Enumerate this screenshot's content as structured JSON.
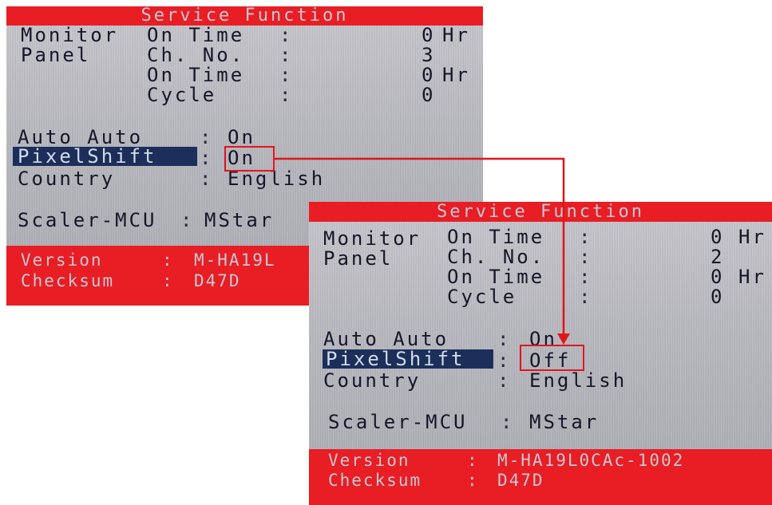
{
  "left_screen": {
    "title": "Service Function",
    "monitor_label": "Monitor",
    "panel_label": "Panel",
    "on_time_label": "On Time",
    "ch_no_label": "Ch. No.",
    "cycle_label": "Cycle",
    "colon": ":",
    "monitor_on_time_value": "0",
    "hr_unit": "Hr",
    "panel_ch_no_value": "3",
    "panel_on_time_value": "0",
    "panel_cycle_value": "0",
    "auto_auto_label": "Auto Auto",
    "auto_auto_value": "On",
    "pixelshift_label": "PixelShift",
    "pixelshift_value": "On",
    "country_label": "Country",
    "country_value": "English",
    "scaler_label": "Scaler-MCU",
    "scaler_value": "MStar",
    "version_label": "Version",
    "version_value": "M-HA19L",
    "checksum_label": "Checksum",
    "checksum_value": "D47D"
  },
  "right_screen": {
    "title": "Service Function",
    "monitor_label": "Monitor",
    "panel_label": "Panel",
    "on_time_label": "On Time",
    "ch_no_label": "Ch. No.",
    "cycle_label": "Cycle",
    "colon": ":",
    "monitor_on_time_value": "0",
    "hr_unit": "Hr",
    "panel_ch_no_value": "2",
    "panel_on_time_value": "0",
    "panel_cycle_value": "0",
    "auto_auto_label": "Auto Auto",
    "auto_auto_value": "On",
    "pixelshift_label": "PixelShift",
    "pixelshift_value": "Off",
    "country_label": "Country",
    "country_value": "English",
    "scaler_label": "Scaler-MCU",
    "scaler_value": "MStar",
    "version_label": "Version",
    "version_value": "M-HA19L0CAc-1002",
    "checksum_label": "Checksum",
    "checksum_value": "D47D"
  },
  "colors": {
    "osd_red": "#e81e24",
    "osd_gray": "#b3b3ba",
    "highlight_navy": "#1b2f5a",
    "callout_red": "#e0161c"
  }
}
